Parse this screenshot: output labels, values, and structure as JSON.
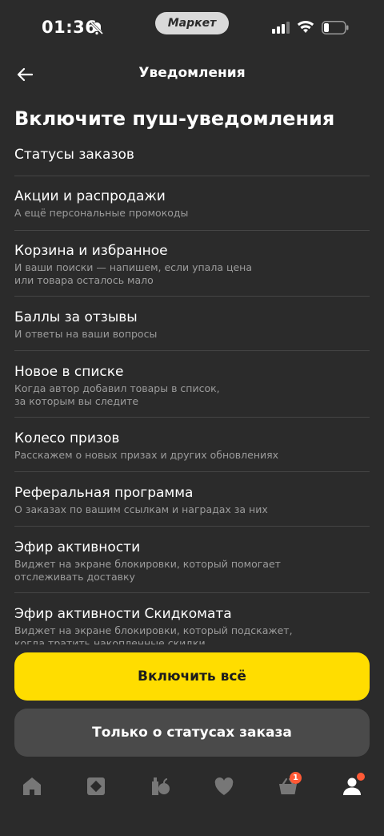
{
  "status_bar": {
    "time": "01:36",
    "app_pill": "Маркет"
  },
  "header": {
    "title": "Уведомления"
  },
  "page": {
    "title": "Включите пуш-уведомления"
  },
  "items": [
    {
      "title": "Статусы заказов",
      "subtitle": ""
    },
    {
      "title": "Акции и распродажи",
      "subtitle": "А ещё персональные промокоды"
    },
    {
      "title": "Корзина и избранное",
      "subtitle": "И ваши поиски — напишем, если упала цена\nили товара осталось мало"
    },
    {
      "title": "Баллы за отзывы",
      "subtitle": "И ответы на ваши вопросы"
    },
    {
      "title": "Новое в списке",
      "subtitle": "Когда автор добавил товары в список,\nза которым вы следите"
    },
    {
      "title": "Колесо призов",
      "subtitle": "Расскажем о новых призах и других обновлениях"
    },
    {
      "title": "Реферальная программа",
      "subtitle": "О заказах по вашим ссылкам и наградах за них"
    },
    {
      "title": "Эфир активности",
      "subtitle": "Виджет на экране блокировки, который помогает\nотслеживать доставку"
    },
    {
      "title": "Эфир активности Скидкомата",
      "subtitle": "Виджет на экране блокировки, который подскажет,\nкогда тратить накопленные скидки"
    }
  ],
  "buttons": {
    "enable_all": "Включить всё",
    "only_order_status": "Только о статусах заказа"
  },
  "tabbar": {
    "cart_badge": "1",
    "tabs": [
      "home-icon",
      "catalog-icon",
      "fresh-products-icon",
      "heart-icon",
      "cart-icon",
      "profile-icon"
    ]
  },
  "colors": {
    "background": "#2b2b2b",
    "accent_yellow": "#ffdd00",
    "secondary_button": "#4a4a4a",
    "badge": "#ff5a36",
    "subtitle_text": "#9c9c9c"
  }
}
